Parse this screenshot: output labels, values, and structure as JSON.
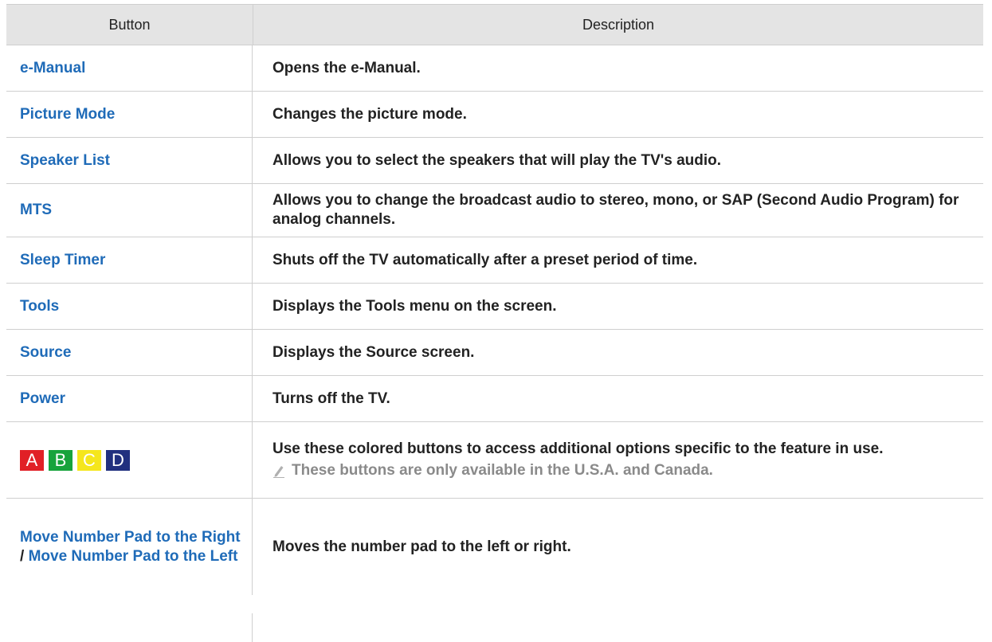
{
  "table": {
    "headers": {
      "button": "Button",
      "description": "Description"
    },
    "rows": [
      {
        "button": "e-Manual",
        "description": "Opens the e-Manual."
      },
      {
        "button": "Picture Mode",
        "description": "Changes the picture mode."
      },
      {
        "button": "Speaker List",
        "description": "Allows you to select the speakers that will play the TV's audio."
      },
      {
        "button": "MTS",
        "description": "Allows you to change the broadcast audio to stereo, mono, or SAP (Second Audio Program) for analog channels."
      },
      {
        "button": "Sleep Timer",
        "description": "Shuts off the TV automatically after a preset period of time."
      },
      {
        "button": "Tools",
        "description": "Displays the Tools menu on the screen."
      },
      {
        "button": "Source",
        "description": "Displays the Source screen."
      },
      {
        "button": "Power",
        "description": "Turns off the TV."
      }
    ],
    "color_row": {
      "buttons": [
        {
          "label": "A",
          "color": "#e12026"
        },
        {
          "label": "B",
          "color": "#17a33c"
        },
        {
          "label": "C",
          "color": "#f5e61c"
        },
        {
          "label": "D",
          "color": "#21307f"
        }
      ],
      "description": "Use these colored buttons to access additional options specific to the feature in use.",
      "note": "These buttons are only available in the U.S.A. and Canada.",
      "note_icon": "pencil-note-icon"
    },
    "last_row": {
      "button_part1": "Move Number Pad to the Right",
      "separator": "/",
      "button_part2": "Move Number Pad to the Left",
      "description": "Moves the number pad to the left or right."
    }
  },
  "colors": {
    "link": "#1f6bb8",
    "header_bg": "#e4e4e4",
    "note": "#8a8a8a"
  }
}
